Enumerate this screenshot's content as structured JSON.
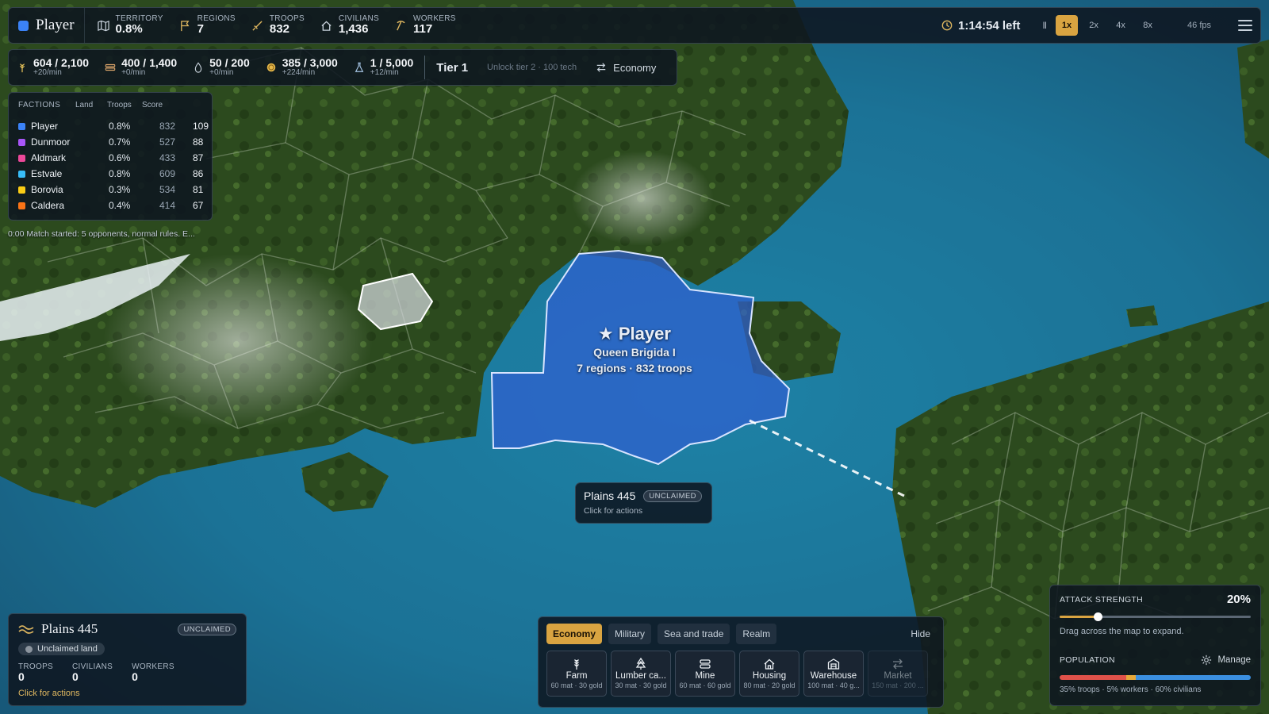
{
  "topbar": {
    "player_name": "Player",
    "player_color": "#3b82f6",
    "stats": [
      {
        "icon": "map-icon",
        "label": "TERRITORY",
        "value": "0.8%"
      },
      {
        "icon": "flag-icon",
        "label": "REGIONS",
        "value": "7"
      },
      {
        "icon": "sword-icon",
        "label": "TROOPS",
        "value": "832"
      },
      {
        "icon": "house-icon",
        "label": "CIVILIANS",
        "value": "1,436"
      },
      {
        "icon": "pickaxe-icon",
        "label": "WORKERS",
        "value": "117"
      }
    ],
    "time_left": "1:14:54 left",
    "pause_glyph": "II",
    "speeds": [
      "1x",
      "2x",
      "4x",
      "8x"
    ],
    "active_speed": "1x",
    "fps": "46 fps"
  },
  "resources": {
    "items": [
      {
        "icon": "wheat-icon",
        "value": "604 / 2,100",
        "rate": "+20/min",
        "color": "#e6c35a"
      },
      {
        "icon": "lumber-icon",
        "value": "400 / 1,400",
        "rate": "+0/min",
        "color": "#d9a46a"
      },
      {
        "icon": "oil-drop-icon",
        "value": "50 / 200",
        "rate": "+0/min",
        "color": "#c8d2dc"
      },
      {
        "icon": "gold-coin-icon",
        "value": "385 / 3,000",
        "rate": "+224/min",
        "color": "#e6b84a"
      },
      {
        "icon": "flask-icon",
        "value": "1 / 5,000",
        "rate": "+12/min",
        "color": "#a8c7e8"
      }
    ],
    "tier": "Tier 1",
    "unlock_text": "Unlock tier 2 · 100 tech",
    "mode_button": "Economy"
  },
  "factions": {
    "headers": [
      "FACTIONS",
      "Land",
      "Troops",
      "Score"
    ],
    "rows": [
      {
        "name": "Player",
        "color": "#3b82f6",
        "land": "0.8%",
        "troops": "832",
        "score": "109"
      },
      {
        "name": "Dunmoor",
        "color": "#a855f7",
        "land": "0.7%",
        "troops": "527",
        "score": "88"
      },
      {
        "name": "Aldmark",
        "color": "#ec4899",
        "land": "0.6%",
        "troops": "433",
        "score": "87"
      },
      {
        "name": "Estvale",
        "color": "#38bdf8",
        "land": "0.8%",
        "troops": "609",
        "score": "86"
      },
      {
        "name": "Borovia",
        "color": "#facc15",
        "land": "0.3%",
        "troops": "534",
        "score": "81"
      },
      {
        "name": "Caldera",
        "color": "#f97316",
        "land": "0.4%",
        "troops": "414",
        "score": "67"
      }
    ]
  },
  "log_line": "0:00  Match started: 5 opponents, normal rules. E...",
  "map": {
    "player_label": "★ Player",
    "ruler": "Queen Brigida I",
    "info": "7 regions · 832 troops"
  },
  "tooltip": {
    "title": "Plains 445",
    "badge": "UNCLAIMED",
    "hint": "Click for actions"
  },
  "region_panel": {
    "title": "Plains 445",
    "badge": "UNCLAIMED",
    "status": "Unclaimed land",
    "stats": [
      {
        "label": "TROOPS",
        "value": "0"
      },
      {
        "label": "CIVILIANS",
        "value": "0"
      },
      {
        "label": "WORKERS",
        "value": "0"
      }
    ],
    "hint": "Click for actions"
  },
  "build_panel": {
    "tabs": [
      "Economy",
      "Military",
      "Sea and trade",
      "Realm"
    ],
    "active_tab": "Economy",
    "hide_label": "Hide",
    "items": [
      {
        "icon": "farm-icon",
        "name": "Farm",
        "cost": "60 mat · 30 gold",
        "disabled": false
      },
      {
        "icon": "lumber-camp-icon",
        "name": "Lumber ca...",
        "cost": "30 mat · 30 gold",
        "disabled": false
      },
      {
        "icon": "mine-icon",
        "name": "Mine",
        "cost": "60 mat · 60 gold",
        "disabled": false
      },
      {
        "icon": "housing-icon",
        "name": "Housing",
        "cost": "80 mat · 20 gold",
        "disabled": false
      },
      {
        "icon": "warehouse-icon",
        "name": "Warehouse",
        "cost": "100 mat · 40 g...",
        "disabled": false
      },
      {
        "icon": "market-icon",
        "name": "Market",
        "cost": "150 mat · 200 ...",
        "disabled": true
      }
    ]
  },
  "attack_panel": {
    "label": "ATTACK STRENGTH",
    "percent_text": "20%",
    "strength_fraction": 0.2,
    "hint": "Drag across the map to expand.",
    "population_label": "POPULATION",
    "manage_label": "Manage",
    "population_split": [
      {
        "name": "troops",
        "fraction": 0.35,
        "color": "#e0524a"
      },
      {
        "name": "workers",
        "fraction": 0.05,
        "color": "#e6a83a"
      },
      {
        "name": "civilians",
        "fraction": 0.6,
        "color": "#3b8fe0"
      }
    ],
    "population_text": "35% troops · 5% workers · 60% civilians"
  }
}
